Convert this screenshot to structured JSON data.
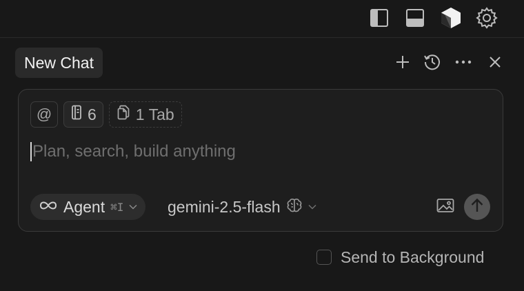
{
  "topbar": {
    "icons": [
      "toggle-sidebar-icon",
      "toggle-panel-icon",
      "cursor-cube-icon",
      "settings-gear-icon"
    ]
  },
  "chat_header": {
    "tab_label": "New Chat",
    "icons": [
      "plus-icon",
      "history-icon",
      "more-icon",
      "close-icon"
    ]
  },
  "composer": {
    "context": {
      "at_symbol": "@",
      "rules_count": "6",
      "tab_chip": "1 Tab"
    },
    "placeholder": "Plan, search, build anything",
    "mode": {
      "label": "Agent",
      "shortcut": "⌘I"
    },
    "model": {
      "label": "gemini-2.5-flash"
    }
  },
  "send_to_background": {
    "label": "Send to Background",
    "checked": false
  },
  "colors": {
    "background": "#181818",
    "composer_bg": "#1e1e1e",
    "border": "#3b3b3b",
    "send_button": "#555555"
  }
}
